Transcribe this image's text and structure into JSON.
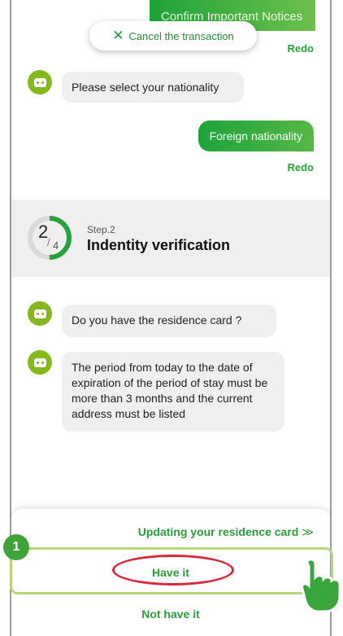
{
  "top_notice": {
    "label": "Confirm Important Notices"
  },
  "cancel_button": {
    "label": "Cancel the transaction",
    "icon": "close-icon"
  },
  "redo_label": "Redo",
  "messages": [
    {
      "from": "bot",
      "text": "Please select your nationality"
    },
    {
      "from": "user",
      "text": "Foreign nationality"
    }
  ],
  "step": {
    "current": "2",
    "total": "4",
    "label": "Step.2",
    "title": "Indentity verification",
    "progress_fraction": 0.5
  },
  "bot_messages_step2": [
    "Do you have the residence card ?",
    "The period from today to the date of expiration of the period of stay must be more than 3 months and the current address must be listed"
  ],
  "options": {
    "updating": "Updating your residence card",
    "have_it": "Have it",
    "not_have_it": "Not have it"
  },
  "annotation": {
    "badge_number": "1"
  },
  "colors": {
    "accent_green": "#27a23c",
    "bot_avatar": "#86b81e",
    "highlight": "#b7d67a",
    "ring": "#d62a3c"
  }
}
